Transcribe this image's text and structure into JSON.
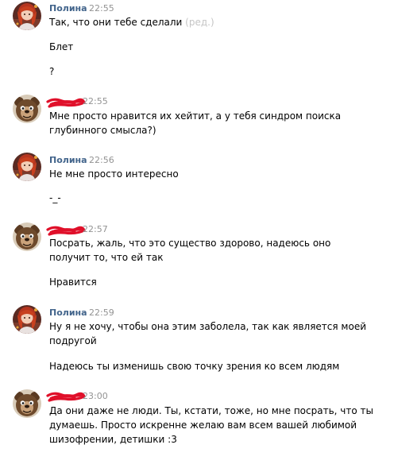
{
  "messages": [
    {
      "author": "Полина",
      "time": "22:55",
      "edited_label": "(ред.)",
      "lines": [
        "Так, что они тебе сделали",
        "Блет",
        "?"
      ]
    },
    {
      "author": "",
      "time": "22:55",
      "lines": [
        "Мне просто нравится их хейтит, а у тебя синдром поиска",
        "глубинного смысла?)"
      ]
    },
    {
      "author": "Полина",
      "time": "22:56",
      "lines": [
        "Не мне просто интересно",
        "-_-"
      ]
    },
    {
      "author": "",
      "time": "22:57",
      "lines": [
        "Посрать, жаль, что это существо здорово, надеюсь оно",
        "получит то, что ей так",
        "Нравится"
      ]
    },
    {
      "author": "Полина",
      "time": "22:59",
      "lines": [
        "Ну я не хочу, чтобы она этим заболела, так как является моей",
        "подругой",
        "Надеюсь ты изменишь свою точку зрения ко всем людям"
      ]
    },
    {
      "author": "",
      "time": "23:00",
      "lines": [
        "Да они даже не люди. Ты, кстати, тоже, но мне посрать, что ты",
        "думаешь. Просто искренне желаю вам всем вашей любимой",
        "шизофрении, детишки :3"
      ]
    }
  ],
  "colors": {
    "author_name": "#42648b",
    "timestamp": "#939393",
    "edited": "#c5c5c5",
    "scribble": "#e0102a",
    "text": "#000000"
  },
  "icons": {
    "polina_avatar": "girl-portrait-red-hair-avatar",
    "other_avatar": "bear-face-avatar"
  }
}
